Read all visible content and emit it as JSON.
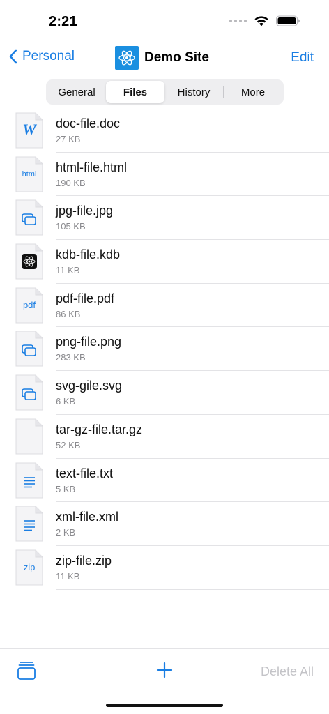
{
  "status_bar": {
    "time": "2:21"
  },
  "nav": {
    "back_label": "Personal",
    "title": "Demo Site",
    "edit_label": "Edit"
  },
  "tabs": [
    {
      "label": "General",
      "active": false
    },
    {
      "label": "Files",
      "active": true
    },
    {
      "label": "History",
      "active": false
    },
    {
      "label": "More",
      "active": false
    }
  ],
  "files": [
    {
      "name": "doc-file.doc",
      "size": "27 KB",
      "icon": "word-doc-icon",
      "icon_text": "W"
    },
    {
      "name": "html-file.html",
      "size": "190 KB",
      "icon": "html-file-icon",
      "icon_text": "html"
    },
    {
      "name": "jpg-file.jpg",
      "size": "105 KB",
      "icon": "image-file-icon",
      "icon_text": ""
    },
    {
      "name": "kdb-file.kdb",
      "size": "11 KB",
      "icon": "kdb-file-icon",
      "icon_text": ""
    },
    {
      "name": "pdf-file.pdf",
      "size": "86 KB",
      "icon": "pdf-file-icon",
      "icon_text": "pdf"
    },
    {
      "name": "png-file.png",
      "size": "283 KB",
      "icon": "image-file-icon",
      "icon_text": ""
    },
    {
      "name": "svg-gile.svg",
      "size": "6 KB",
      "icon": "image-file-icon",
      "icon_text": ""
    },
    {
      "name": "tar-gz-file.tar.gz",
      "size": "52 KB",
      "icon": "blank-file-icon",
      "icon_text": ""
    },
    {
      "name": "text-file.txt",
      "size": "5 KB",
      "icon": "text-file-icon",
      "icon_text": ""
    },
    {
      "name": "xml-file.xml",
      "size": "2 KB",
      "icon": "text-file-icon",
      "icon_text": ""
    },
    {
      "name": "zip-file.zip",
      "size": "11 KB",
      "icon": "zip-file-icon",
      "icon_text": "zip"
    }
  ],
  "toolbar": {
    "delete_all_label": "Delete All"
  },
  "colors": {
    "accent": "#1a7ee3",
    "logo_bg": "#1a8fe0",
    "disabled": "#c4c4c8"
  }
}
